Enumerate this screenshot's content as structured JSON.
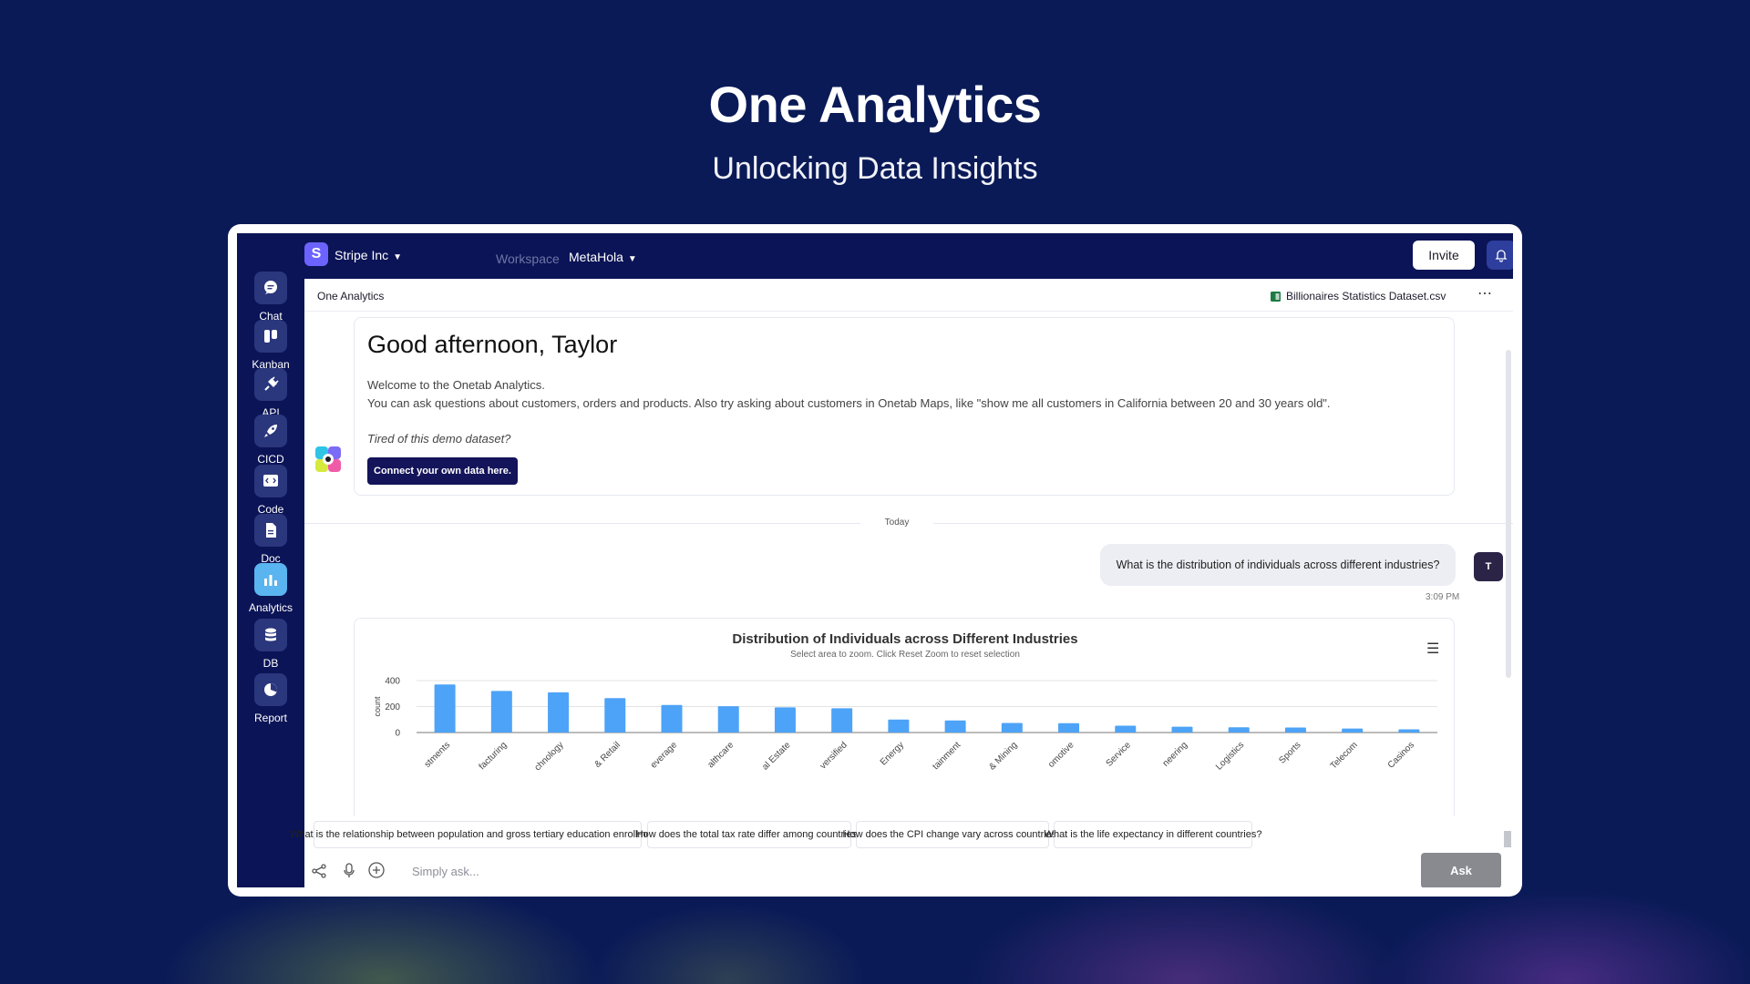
{
  "hero": {
    "title": "One Analytics",
    "subtitle": "Unlocking Data Insights"
  },
  "topbar": {
    "org_initial": "S",
    "org_name": "Stripe Inc",
    "workspace_label": "Workspace",
    "workspace_name": "MetaHola",
    "invite_label": "Invite"
  },
  "sidebar": {
    "items": [
      {
        "label": "Chat",
        "icon": "chat-icon"
      },
      {
        "label": "Kanban",
        "icon": "kanban-icon"
      },
      {
        "label": "API",
        "icon": "api-plug-icon"
      },
      {
        "label": "CICD",
        "icon": "rocket-icon"
      },
      {
        "label": "Code",
        "icon": "code-icon"
      },
      {
        "label": "Doc",
        "icon": "document-icon"
      },
      {
        "label": "Analytics",
        "icon": "bar-chart-icon",
        "active": true
      },
      {
        "label": "DB",
        "icon": "database-icon"
      },
      {
        "label": "Report",
        "icon": "pie-chart-icon"
      }
    ]
  },
  "main": {
    "title": "One Analytics",
    "dataset": "Billionaires Statistics Dataset.csv"
  },
  "welcome": {
    "greeting": "Good afternoon, Taylor",
    "line1": "Welcome to the Onetab Analytics.",
    "line2": "You can ask questions about customers, orders and products. Also try asking about customers in Onetab Maps, like \"show me all customers in California between 20 and 30 years old\".",
    "tired": "Tired of this demo dataset?",
    "connect_label": "Connect your own data here."
  },
  "divider_label": "Today",
  "user_message": {
    "avatar_initial": "T",
    "text": "What is the distribution of individuals across different industries?",
    "time": "3:09 PM"
  },
  "chart_data": {
    "type": "bar",
    "title": "Distribution of Individuals across Different Industries",
    "subtitle": "Select area to zoom. Click Reset Zoom to reset selection",
    "ylabel": "count",
    "xlabel": "",
    "ylim": [
      0,
      400
    ],
    "yticks": [
      0,
      200,
      400
    ],
    "grid": true,
    "legend": "none",
    "categories": [
      "stments",
      "facturing",
      "chnology",
      "& Retail",
      "everage",
      "althcare",
      "al Estate",
      "versified",
      "Energy",
      "tainment",
      "& Mining",
      "omotive",
      "Service",
      "neering",
      "Logistics",
      "Sports",
      "Telecom",
      "Casinos"
    ],
    "values": [
      370,
      320,
      310,
      265,
      212,
      203,
      194,
      187,
      100,
      93,
      74,
      72,
      53,
      45,
      40,
      39,
      31,
      25
    ],
    "bar_color": "#4da3f7"
  },
  "suggestions": [
    "What is the relationship between population and gross tertiary education enrollment?",
    "How does the total tax rate differ among countries?",
    "How does the CPI change vary across countries?",
    "What is the life expectancy in different countries?"
  ],
  "input": {
    "placeholder": "Simply ask...",
    "ask_label": "Ask"
  },
  "colors": {
    "page_bg": "#0a1a57",
    "sidebar_bg": "#0b1456",
    "active_accent": "#5ab4ef",
    "connect_btn": "#14145a"
  }
}
